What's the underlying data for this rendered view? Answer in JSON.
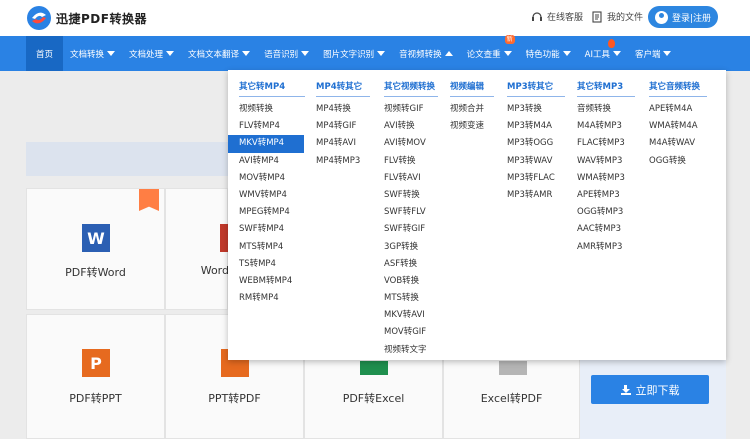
{
  "brand": {
    "name": "迅捷PDF转换器"
  },
  "header": {
    "service_link": "在线客服",
    "files_link": "我的文件",
    "login_label": "登录|注册"
  },
  "nav": {
    "home": "首页",
    "items": [
      "文档转换",
      "文档处理",
      "文档文本翻译",
      "语音识别",
      "图片文字识别",
      "音视频转换",
      "论文查重",
      "特色功能",
      "AI工具",
      "客户端"
    ],
    "new_badge": "新"
  },
  "dropdown": {
    "columns": [
      {
        "title": "其它转MP4",
        "items": [
          "视频转换",
          "FLV转MP4",
          "MKV转MP4",
          "AVI转MP4",
          "MOV转MP4",
          "WMV转MP4",
          "MPEG转MP4",
          "SWF转MP4",
          "MTS转MP4",
          "TS转MP4",
          "WEBM转MP4",
          "RM转MP4"
        ]
      },
      {
        "title": "MP4转其它",
        "items": [
          "MP4转换",
          "MP4转GIF",
          "MP4转AVI",
          "MP4转MP3"
        ]
      },
      {
        "title": "其它视频转换",
        "items": [
          "视频转GIF",
          "AVI转换",
          "AVI转MOV",
          "FLV转换",
          "FLV转AVI",
          "SWF转换",
          "SWF转FLV",
          "SWF转GIF",
          "3GP转换",
          "ASF转换",
          "VOB转换",
          "MTS转换",
          "MKV转AVI",
          "MOV转GIF",
          "视频转文字"
        ]
      },
      {
        "title": "视频编辑",
        "items": [
          "视频合并",
          "视频变速"
        ]
      },
      {
        "title": "MP3转其它",
        "items": [
          "MP3转换",
          "MP3转M4A",
          "MP3转OGG",
          "MP3转WAV",
          "MP3转FLAC",
          "MP3转AMR"
        ]
      },
      {
        "title": "其它转MP3",
        "items": [
          "音频转换",
          "M4A转MP3",
          "FLAC转MP3",
          "WAV转MP3",
          "WMA转MP3",
          "APE转MP3",
          "OGG转MP3",
          "AAC转MP3",
          "AMR转MP3"
        ]
      },
      {
        "title": "其它音频转换",
        "items": [
          "APE转M4A",
          "WMA转M4A",
          "M4A转WAV",
          "OGG转换"
        ]
      }
    ]
  },
  "cards": {
    "pdf_word": "PDF转Word",
    "word_partial": "Word",
    "pdf_ppt": "PDF转PPT",
    "ppt_pdf": "PPT转PDF",
    "pdf_excel": "PDF转Excel",
    "excel_pdf": "Excel转PDF",
    "word_tile": "W",
    "ppt_tile": "P"
  },
  "download": {
    "label": "立即下载"
  },
  "colors": {
    "primary": "#2a82e4",
    "active_nav": "#1868c4",
    "highlight": "#1f6fd1",
    "badge": "#ff6a2f"
  }
}
